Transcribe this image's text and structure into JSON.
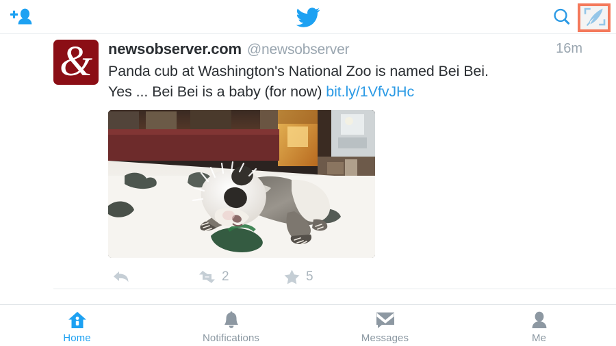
{
  "app": {
    "name": "Twitter",
    "accent_color": "#1da1f2",
    "highlight_color": "#f4795b"
  },
  "topbar": {
    "add_person_label": "Add people",
    "logo_label": "Twitter logo",
    "search_label": "Search",
    "compose_label": "Compose new Tweet",
    "compose_highlighted": true
  },
  "tweet": {
    "avatar_glyph": "&",
    "avatar_color": "#8b0e15",
    "display_name": "newsobserver.com",
    "handle": "@newsobserver",
    "timestamp": "16m",
    "text_line1": "Panda cub at Washington's National Zoo is named Bei Bei.",
    "text_line2_prefix": "Yes ... Bei Bei is a baby (for now) ",
    "link_text": "bit.ly/1VfvJHc",
    "photo_alt": "Panda cub lying on a white blanket",
    "actions": {
      "reply_label": "Reply",
      "retweet_label": "Retweet",
      "retweet_count": "2",
      "favorite_label": "Favorite",
      "favorite_count": "5"
    }
  },
  "bottom_nav": {
    "items": [
      {
        "label": "Home",
        "icon": "home-icon",
        "active": true
      },
      {
        "label": "Notifications",
        "icon": "bell-icon",
        "active": false
      },
      {
        "label": "Messages",
        "icon": "envelope-icon",
        "active": false
      },
      {
        "label": "Me",
        "icon": "person-icon",
        "active": false
      }
    ]
  }
}
